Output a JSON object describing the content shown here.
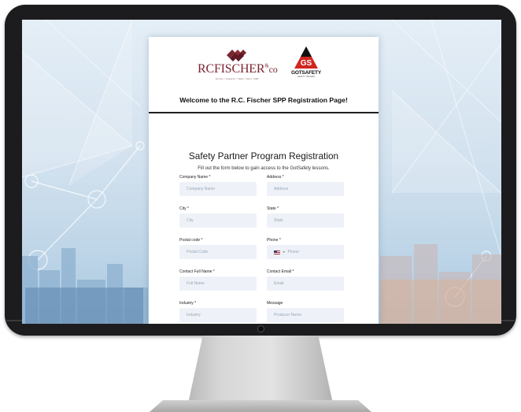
{
  "brand": {
    "rcfischer": {
      "name": "RCFISCHER",
      "sup": "&",
      "co": "co",
      "tagline": "Service • Integrity • Value • Since 1998"
    },
    "gotsafety": {
      "monogram": "GS",
      "name": "GOTSAFETY",
      "sub": "SAFETY TRAINING"
    }
  },
  "welcome": "Welcome to the R.C. Fischer SPP Registration Page!",
  "form": {
    "title": "Safety Partner Program Registration",
    "subtitle": "Fill out the form below to gain access to the GotSafety lessons.",
    "fields": [
      {
        "label": "Company Name *",
        "placeholder": "Company Name"
      },
      {
        "label": "Address *",
        "placeholder": "Address"
      },
      {
        "label": "City *",
        "placeholder": "City"
      },
      {
        "label": "State *",
        "placeholder": "State"
      },
      {
        "label": "Postal code *",
        "placeholder": "Postal Code"
      },
      {
        "label": "Phone *",
        "placeholder": "Phone",
        "country_flag": "us-flag-icon"
      },
      {
        "label": "Contact Full Name *",
        "placeholder": "Full Name"
      },
      {
        "label": "Contact Email *",
        "placeholder": "Email"
      },
      {
        "label": "Industry *",
        "placeholder": "Industry"
      },
      {
        "label": "Message",
        "placeholder": "Producer Name"
      }
    ]
  },
  "colors": {
    "rcf_maroon": "#7a2530",
    "gs_red": "#d0271f",
    "input_bg": "#eef2f8",
    "bezel": "#1c1c1e"
  }
}
